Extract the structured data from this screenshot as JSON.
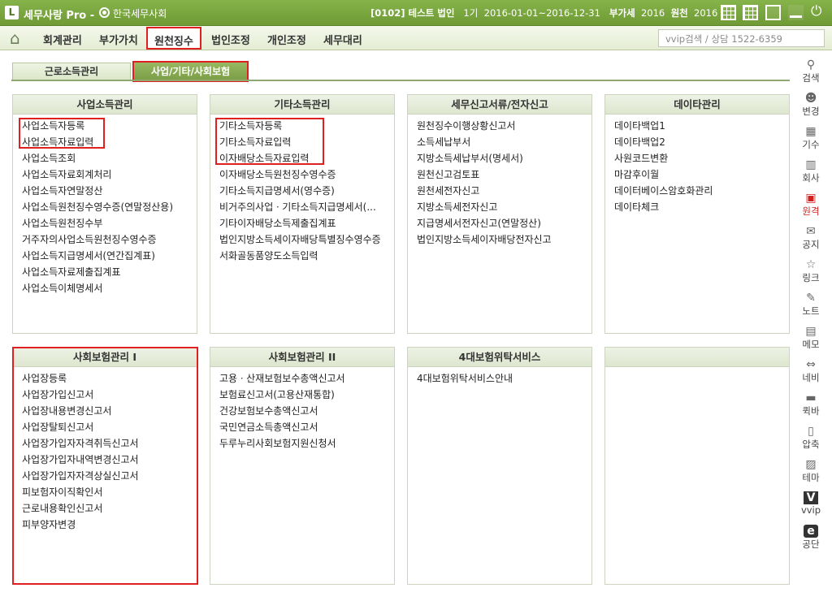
{
  "titlebar": {
    "logo": "L",
    "app_title": "세무사랑 Pro -",
    "org": "한국세무사회",
    "company": "[0102] 테스트 법인",
    "term": "1기",
    "period": "2016-01-01~2016-12-31",
    "vat_label": "부가세",
    "vat_year": "2016",
    "wh_label": "원천",
    "wh_year": "2016"
  },
  "menu": {
    "items": [
      "회계관리",
      "부가가치",
      "원천징수",
      "법인조정",
      "개인조정",
      "세무대리"
    ],
    "active": "원천징수",
    "search_placeholder": "vvip검색 / 상담 1522-6359"
  },
  "subtabs": [
    "근로소득관리",
    "사업/기타/사회보험"
  ],
  "panels": [
    {
      "title": "사업소득관리",
      "items": [
        "사업소득자등록",
        "사업소득자료입력",
        "사업소득조회",
        "사업소득자료회계처리",
        "사업소득자연말정산",
        "사업소득원천징수영수증(연말정산용)",
        "사업소득원천징수부",
        "거주자의사업소득원천징수영수증",
        "사업소득지급명세서(연간집계표)",
        "사업소득자료제출집계표",
        "사업소득이체명세서"
      ]
    },
    {
      "title": "기타소득관리",
      "items": [
        "기타소득자등록",
        "기타소득자료입력",
        "이자배당소득자료입력",
        "이자배당소득원천징수영수증",
        "기타소득지급명세서(영수증)",
        "비거주의사업ㆍ기타소득지급명세서(...",
        "기타이자배당소득제출집계표",
        "법인지방소득세이자배당특별징수영수증",
        "서화골동품양도소득입력"
      ]
    },
    {
      "title": "세무신고서류/전자신고",
      "items": [
        "원천징수이행상황신고서",
        "소득세납부서",
        "지방소득세납부서(명세서)",
        "원천신고검토표",
        "원천세전자신고",
        "지방소득세전자신고",
        "지급명세서전자신고(연말정산)",
        "법인지방소득세이자배당전자신고"
      ]
    },
    {
      "title": "데이타관리",
      "items": [
        "데이타백업1",
        "데이타백업2",
        "사원코드변환",
        "마감후이월",
        "데이터베이스암호화관리",
        "데이타체크"
      ]
    },
    {
      "title": "사회보험관리 I",
      "items": [
        "사업장등록",
        "사업장가입신고서",
        "사업장내용변경신고서",
        "사업장탈퇴신고서",
        "사업장가입자자격취득신고서",
        "사업장가입자내역변경신고서",
        "사업장가입자자격상실신고서",
        "피보험자이직확인서",
        "근로내용확인신고서",
        "피부양자변경"
      ]
    },
    {
      "title": "사회보험관리 II",
      "items": [
        "고용ㆍ산재보험보수총액신고서",
        "보험료신고서(고용산재통합)",
        "건강보험보수총액신고서",
        "국민연금소득총액신고서",
        "두루누리사회보험지원신청서"
      ]
    },
    {
      "title": "4대보험위탁서비스",
      "items": [
        "4대보험위탁서비스안내"
      ]
    },
    {
      "title": "",
      "items": []
    }
  ],
  "sidebar": [
    "검색",
    "변경",
    "기수",
    "회사",
    "원격",
    "공지",
    "링크",
    "노트",
    "메모",
    "네비",
    "퀵바",
    "압축",
    "테마",
    "vvip",
    "공단"
  ],
  "colors": {
    "titlebar": "#7aa33e",
    "highlight": "#e02020",
    "accent_text": "#d02020"
  }
}
